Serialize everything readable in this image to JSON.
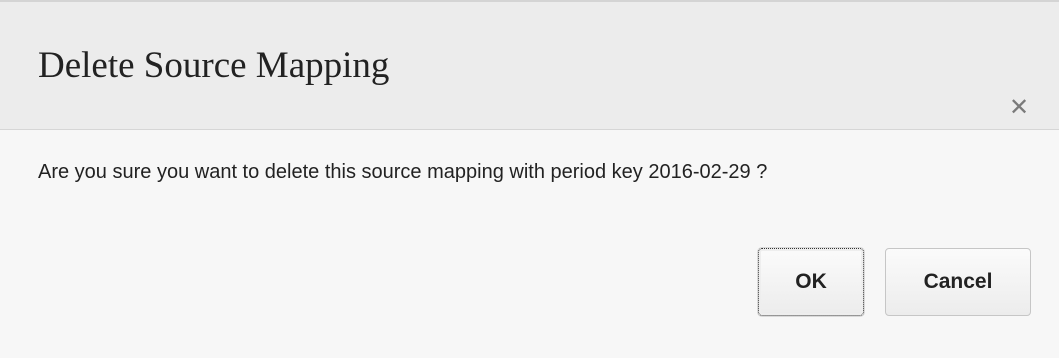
{
  "dialog": {
    "title": "Delete Source Mapping",
    "close_icon": "close-icon",
    "close_glyph": "✕",
    "message": "Are you sure you want to delete this source mapping with period key 2016-02-29 ?",
    "buttons": {
      "ok_label": "OK",
      "cancel_label": "Cancel"
    }
  }
}
